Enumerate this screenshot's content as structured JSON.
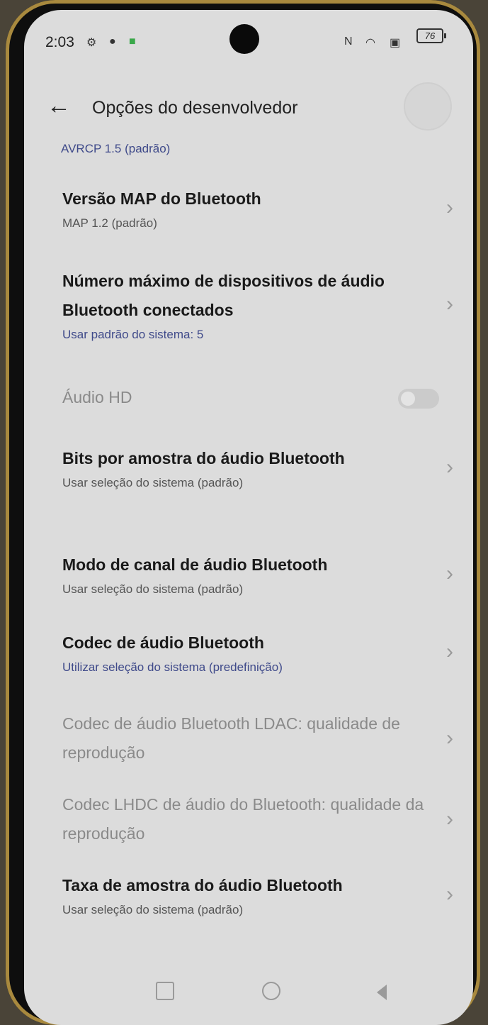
{
  "status_bar": {
    "time": "2:03",
    "battery": "76"
  },
  "header": {
    "back_icon": "arrow-left-icon",
    "title": "Opções do desenvolvedor"
  },
  "top_value": "AVRCP 1.5 (padrão)",
  "items": [
    {
      "title": "Versão MAP do Bluetooth",
      "subtitle": "MAP 1.2 (padrão)",
      "subtitle_color": "gray",
      "enabled": true
    },
    {
      "title": "Número máximo de dispositivos de áudio Bluetooth conectados",
      "subtitle": "Usar padrão do sistema: 5",
      "subtitle_color": "blue",
      "enabled": true
    },
    {
      "title": "Áudio HD",
      "subtitle": "",
      "enabled": false,
      "toggle": "off"
    },
    {
      "title": "Bits por amostra do áudio Bluetooth",
      "subtitle": "Usar seleção do sistema (padrão)",
      "subtitle_color": "gray",
      "enabled": true
    },
    {
      "title": "Modo de canal de áudio Bluetooth",
      "subtitle": "Usar seleção do sistema (padrão)",
      "subtitle_color": "gray",
      "enabled": true
    },
    {
      "title": "Codec de áudio Bluetooth",
      "subtitle": "Utilizar seleção do sistema (predefinição)",
      "subtitle_color": "blue",
      "enabled": true
    },
    {
      "title": "Codec de áudio Bluetooth LDAC: qualidade de reprodução",
      "subtitle": "",
      "enabled": false
    },
    {
      "title": "Codec LHDC de áudio do Bluetooth: qualidade da reprodução",
      "subtitle": "",
      "enabled": false
    },
    {
      "title": "Taxa de amostra do áudio Bluetooth",
      "subtitle": "Usar seleção do sistema (padrão)",
      "subtitle_color": "gray",
      "enabled": true
    }
  ],
  "nav": {
    "recent_icon": "recent-apps-icon",
    "home_icon": "home-icon",
    "back_icon": "back-triangle-icon"
  }
}
